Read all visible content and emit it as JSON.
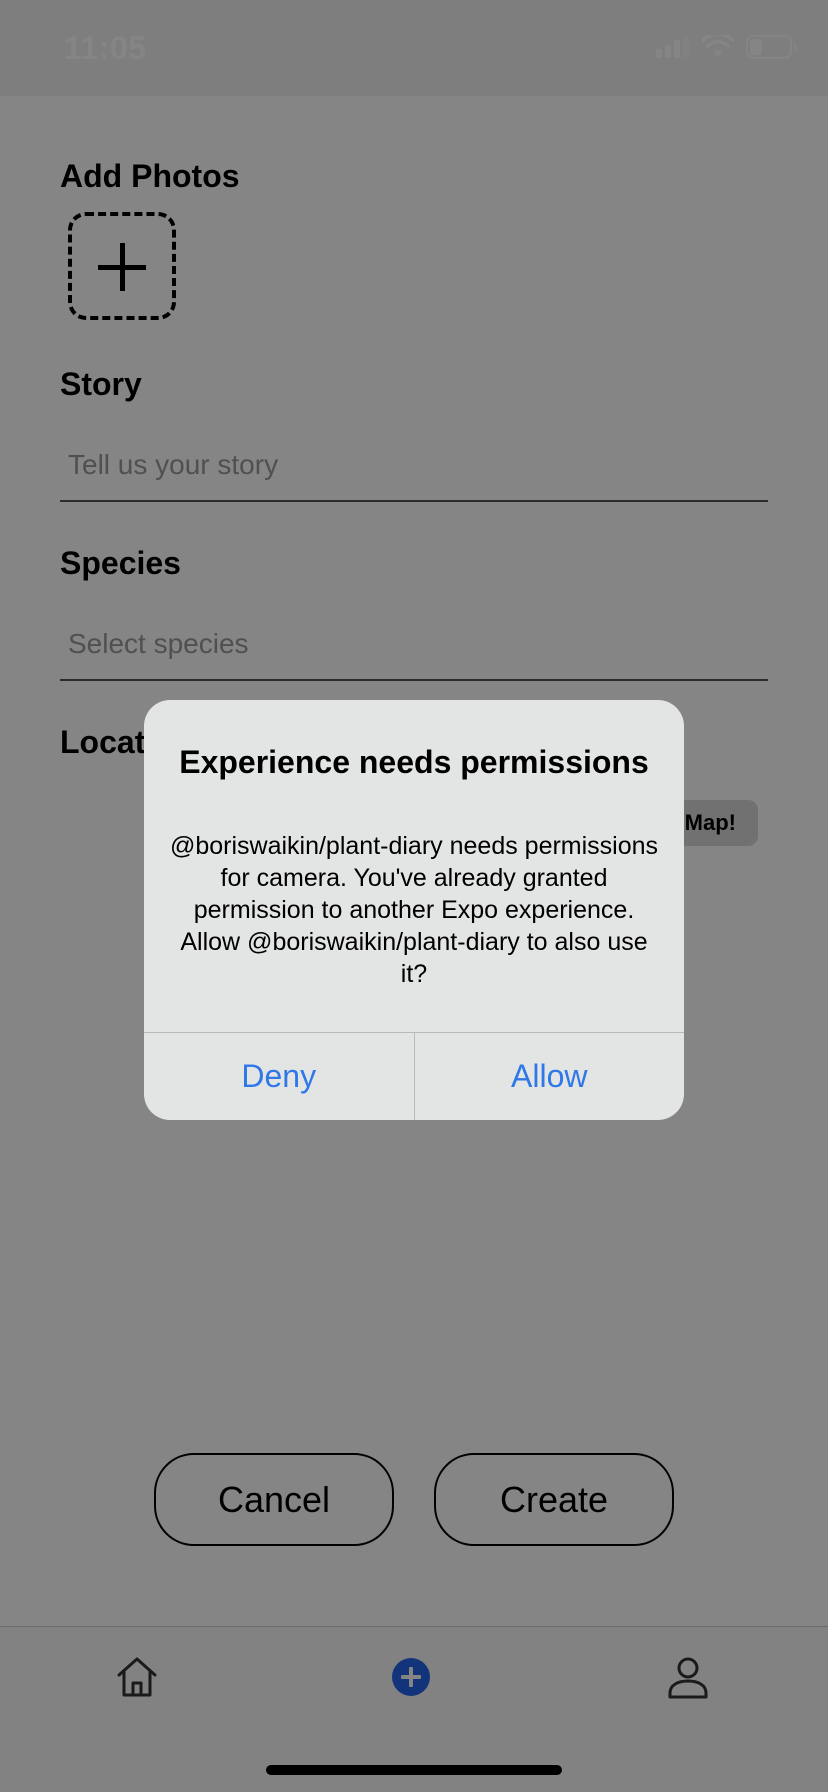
{
  "status_bar": {
    "time": "11:05"
  },
  "form": {
    "add_photos_label": "Add Photos",
    "story_label": "Story",
    "story_placeholder": "Tell us your story",
    "species_label": "Species",
    "species_placeholder": "Select species",
    "location_label": "Locat",
    "map_button_label": "Map!",
    "cancel_label": "Cancel",
    "create_label": "Create"
  },
  "alert": {
    "title": "Experience needs permissions",
    "message": "@boriswaikin/plant-diary needs permissions for camera. You've already granted permission to another Expo experience. Allow @boriswaikin/plant-diary to also use it?",
    "deny_label": "Deny",
    "allow_label": "Allow"
  },
  "tab_bar": {
    "items": [
      {
        "icon": "home-icon"
      },
      {
        "icon": "add-circle-icon",
        "active": true
      },
      {
        "icon": "profile-icon"
      }
    ]
  },
  "colors": {
    "alert_action": "#2f78e8",
    "active_tab": "#2563eb",
    "overlay": "rgba(0,0,0,0.48)"
  }
}
